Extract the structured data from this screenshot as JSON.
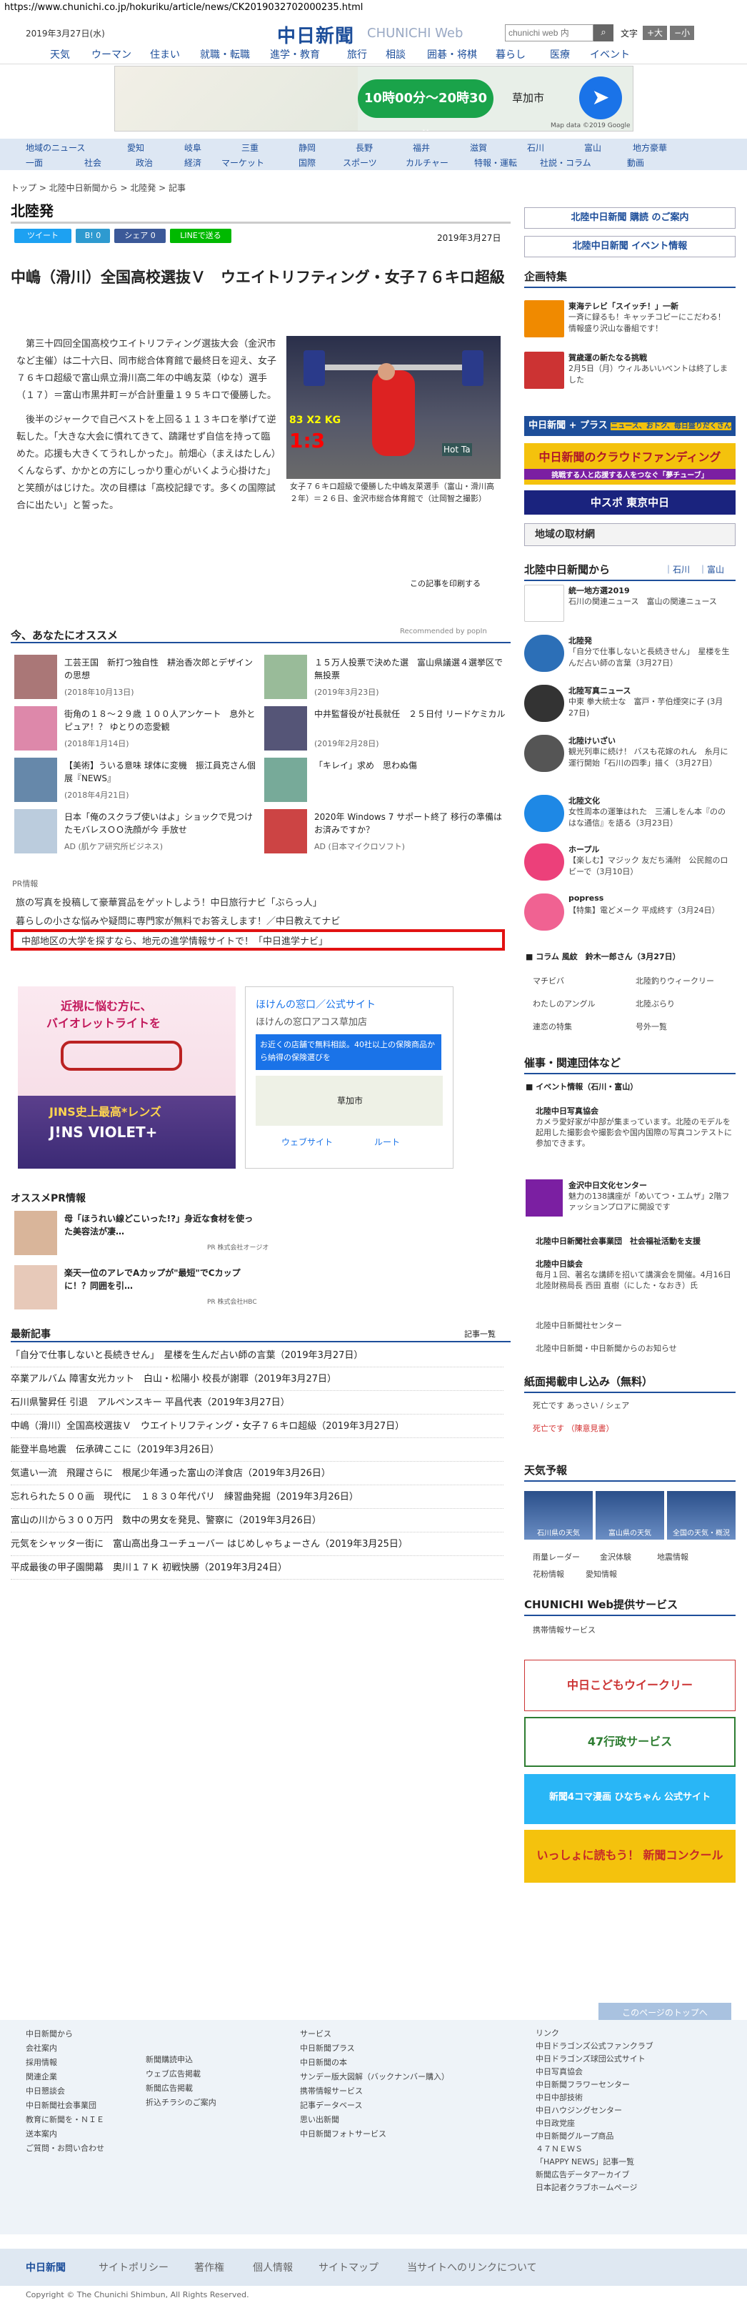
{
  "url": "https://www.chunichi.co.jp/hokuriku/article/news/CK2019032702000235.html",
  "header": {
    "date": "2019年3月27日(水)",
    "logo": "中日新聞",
    "logo_en": "CHUNICHI Web",
    "search_placeholder": "chunichi web 内",
    "font_label": "文字",
    "font_large": "+大",
    "font_small": "−小"
  },
  "nav1": [
    "天気",
    "ウーマン",
    "住まい",
    "就職・転職",
    "進学・教育",
    "旅行",
    "相談",
    "囲碁・将棋",
    "暮らし",
    "医療",
    "イベント"
  ],
  "ad_top": {
    "hours": "10時00分〜20時30分",
    "city": "草加市",
    "map_credit": "Map data ©2019 Google"
  },
  "nav2_row1": [
    "地域のニュース",
    "愛知",
    "岐阜",
    "三重",
    "静岡",
    "長野",
    "福井",
    "滋賀",
    "石川",
    "富山",
    "地方豪華"
  ],
  "nav2_row2": [
    "一面",
    "社会",
    "政治",
    "経済",
    "マーケット",
    "国際",
    "スポーツ",
    "カルチャー",
    "特報・運転",
    "社説・コラム",
    "動画"
  ],
  "breadcrumb": "トップ > 北陸中日新聞から > 北陸発 > 記事",
  "section": "北陸発",
  "share": [
    "ツイート",
    "B! 0",
    "シェア 0",
    "LINEで送る"
  ],
  "article_date": "2019年3月27日",
  "title": "中嶋（滑川）全国高校選抜Ｖ　ウエイトリフティング・女子７６キロ超級",
  "body": [
    "第三十四回全国高校ウエイトリフティング選抜大会（金沢市など主催）は二十六日、同市総合体育館で最終日を迎え、女子７６キロ超級で富山県立滑川高二年の中嶋友菜（ゆな）選手（１７）＝富山市黒井町＝が合計重量１９５キロで優勝した。",
    "後半のジャークで自己ベストを上回る１１３キロを挙げて逆転した。「大きな大会に慣れてきて、躊躇せず自信を持って臨めた。応援も大きくてうれしかった」。前畑心（まえはたしん）くんならず、かかとの方にしっかり重心がいくよう心掛けた」と笑顔がはじけた。次の目標は「高校記録です。多くの国際試合に出たい」と誓った。"
  ],
  "photo": {
    "plates": "83 X2 KG",
    "timer": "1:3",
    "sign": "Hot Ta"
  },
  "caption": "女子７６キロ超級で優勝した中嶋友菜選手（富山・滑川高２年）＝２６日、金沢市総合体育館で（辻岡智之撮影）",
  "print_link": "この記事を印刷する",
  "osusume_title": "今、あなたにオススメ",
  "recommended": "Recommended by  popIn",
  "cards": [
    {
      "t": "工芸王国　新打つ独自性　耕治香次郎とデザインの思想",
      "d": "(2018年10月13日)"
    },
    {
      "t": "１５万人投票で決めた選　富山県議選４選挙区で無投票",
      "d": "(2019年3月23日)"
    },
    {
      "t": "街角の１８〜２９歳 １００人アンケート　息外とピュア！？ ゆとりの恋愛観",
      "d": "(2018年1月14日)"
    },
    {
      "t": "中井監督役が社長就任　２５日付 リードケミカル",
      "d": "(2019年2月28日)"
    },
    {
      "t": "【美術】ういる意味 球体に変機　振江員克さん個展『NEWS』",
      "d": "(2018年4月21日)"
    },
    {
      "t": "「キレイ」求め　思わぬ傷",
      "d": ""
    },
    {
      "t": "日本「俺のスクラブ使いはよ」ショックで見つけたモバレスＯＯ洗顔が今 手放せ",
      "d": "AD (肌ケア研究所ビジネス)"
    },
    {
      "t": "2020年 Windows 7 サポート終了 移行の準備はお済みですか？",
      "d": "AD (日本マイクロソフト)"
    }
  ],
  "pr_label": "PR情報",
  "pr_links": [
    "旅の写真を投稿して豪華賞品をゲットしよう！中日旅行ナビ「ぶらっ人」",
    "暮らしの小さな悩みや疑問に専門家が無料でお答えします！／中日教えてナビ",
    "中部地区の大学を探すなら、地元の進学情報サイトで！「中日進学ナビ」"
  ],
  "ad_glasses": {
    "copy1": "近視に悩む方に、",
    "copy2": "バイオレットライトを",
    "brand1": "JINS史上最高*レンズ",
    "brand2": "J!NS VIOLET+"
  },
  "ad_hoken": {
    "title": "ほけんの窓口／公式サイト",
    "field": "ほけんの窓口アコス草加店",
    "msg": "お近くの店舗で無料相談。40社以上の保険商品から納得の保険選びを",
    "city": "草加市",
    "web": "ウェブサイト",
    "route": "ルート"
  },
  "prinfo_title": "オススメPR情報",
  "prinfo": [
    {
      "t": "母「ほうれい線どこいった!?」身近な食材を使った美容法が凄…",
      "s": "PR  株式会社オージオ"
    },
    {
      "t": "楽天一位のアレでAカップが\"最短\"でCカップに！？同囲を引…",
      "s": "PR  株式会社HBC"
    }
  ],
  "news_title": "最新記事",
  "news_more": "記事一覧",
  "news": [
    "「自分で仕事しないと長続きせん」　星楼を生んだ占い師の言葉（2019年3月27日）",
    "卒業アルバム 障害女光カット　白山・松陽小 校長が謝罪（2019年3月27日）",
    "石川県警昇任 引退　アルペンスキー 平昌代表（2019年3月27日）",
    "中嶋（滑川）全国高校選抜Ｖ　ウエイトリフティング・女子７６キロ超級（2019年3月27日）",
    "能登半島地震　伝承碑ここに（2019年3月26日）",
    "気遣い一流　飛躍さらに　根尾少年通った富山の洋食店（2019年3月26日）",
    "忘れられた５００画　現代に　１８３０年代パリ　練習曲発掘（2019年3月26日）",
    "富山の川から３００万円　数中の男女を発見、警察に（2019年3月26日）",
    "元気をシャッター街に　富山高出身ユーチューバー はじめしゃちょーさん（2019年3月25日）",
    "平成最後の甲子園開幕　奥川１７Ｋ 初戦快勝（2019年3月24日）"
  ],
  "side": {
    "buy": "北陸中日新聞 購読 のご案内",
    "event": "北陸中日新聞 イベント情報",
    "kikaku": "企画特集",
    "k1a": "東海テレビ「スイッチ！」一新",
    "k1b": "一斉に録るも！キャッチコピーにこだわる！情報盛り沢山な番組です！",
    "k2a": "賀歳運の新たなる挑戦",
    "k2b": "2月5日（月）ウィルあいいべントは終了しました",
    "plus": "中日新聞 + プラス",
    "plus2": "ニュース、おトク、毎日盛りだくさん",
    "crowd": "中日新聞のクラウドファンディング",
    "crowd2": "挑戦する人と応援する人をつなぐ「夢チューブ」",
    "chupo": "中スポ 東京中日",
    "chiiki": "地域の取材網",
    "from": "北陸中日新聞から",
    "from_links": "｜石川　｜富山",
    "items": [
      {
        "a": "統一地方選2019",
        "b": "石川の関連ニュース　富山の関連ニュース"
      },
      {
        "a": "北陸発",
        "b": "「自分で仕事しないと長続きせん」　星楼を生んだ占い師の言葉（3月27日）"
      },
      {
        "a": "北陸写真ニュース",
        "b": "中東 拳大統士な　富戸・芋伯煙突に子 (3月27日)"
      },
      {
        "a": "北陸けいざい",
        "b": "観光列車に続け！ バスも花嫁のれん　糸月に運行開始「石川の四季」描く（3月27日）"
      },
      {
        "a": "北陸文化",
        "b": "女性周本の運筆はれた　三浦しをん本『ののはな通信』を語る（3月23日）"
      },
      {
        "a": "ホープル",
        "b": "【楽しむ】マジック 友だち涌附　公民館のロビーで（3月10日）"
      },
      {
        "a": "popress",
        "b": "【特集】電どメーク 平成終す（3月24日）"
      }
    ],
    "column": "■ コラム 風紋　鈴木一郎さん（3月27日）",
    "links": [
      "マチビバ",
      "北陸釣りウィークリー",
      "わたしのアングル",
      "北陸ぶらり",
      "連恋の特集",
      "号外一覧"
    ],
    "events_title": "催事・関連団体など",
    "ev_info": "■ イベント情報（石川・富山）",
    "ev1a": "北陸中日写真協会",
    "ev1b": "カメラ愛好家が中部が集まっています。北陸のモデルを起用した撮影会や撮影会や国内国際の写真コンテストに参加できます。",
    "ev2a": "金沢中日文化センター",
    "ev2b": "魅力の138講座が「めいてつ・エムザ」2階ファッションプロアに開設です",
    "ev3": "北陸中日新聞社会事業団　社会福祉活動を支援",
    "ev4a": "北陸中日談会",
    "ev4b": "毎月１回、著名な講師を招いて講演会を開催。4月16日 北陸財務局長 西田 直樹（にした・なおき）氏",
    "ev5": "北陸中日新聞社センター",
    "ev6": "北陸中日新聞・中日新聞からのお知らせ",
    "shimen": "紙面掲載申し込み（無料）",
    "sh1": "死亡です あっさい / シェア",
    "sh2": "死亡です （陳意見書）",
    "tenki": "天気予報",
    "w": [
      "石川県の天気",
      "富山県の天気",
      "全国の天気・概況"
    ],
    "wlinks": [
      "雨量レーダー",
      "金沢体験",
      "地震情報",
      "花粉情報",
      "愛知情報"
    ],
    "svc": "CHUNICHI Web提供サービス",
    "svc1": "携帯情報サービス",
    "ban1": "中日こどもウイークリー",
    "ban2": "47行政サービス",
    "ban3": "新聞4コマ漫画 ひなちゃん 公式サイト",
    "ban4": "いっしょに読もう！ 新聞コンクール"
  },
  "pagetop": "このページのトップへ",
  "footer": {
    "c1": [
      "中日新聞から",
      "会社案内",
      "採用情報",
      "関連企業",
      "中日懇談会",
      "中日新聞社会事業団",
      "教育に新聞を・ＮＩＥ",
      "送本案内",
      "ご質問・お問い合わせ"
    ],
    "c2": [
      "新聞購読申込",
      "ウェブ広告掲載",
      "新聞広告掲載",
      "折込チラシのご案内"
    ],
    "c3": [
      "サービス",
      "中日新聞プラス",
      "中日新聞の本",
      "サンデー版大図解（バックナンバー購入）",
      "携帯情報サービス",
      "記事データベース",
      "思い出新聞",
      "中日新聞フォトサービス"
    ],
    "c4": [
      "リンク",
      "中日ドラゴンズ公式ファンクラブ",
      "中日ドラゴンズ球団公式サイト",
      "中日写真協会",
      "中日新聞フラワーセンター",
      "中日中部技術",
      "中日ハウジングセンター",
      "中日政党座",
      "中日新聞グループ商品",
      "４７ＮＥＷＳ",
      "「HAPPY NEWS」記事一覧",
      "新聞広告データアーカイブ",
      "日本記者クラブホームページ"
    ]
  },
  "foot2": [
    "中日新聞",
    "サイトポリシー",
    "著作権",
    "個人情報",
    "サイトマップ",
    "当サイトへのリンクについて"
  ],
  "copyright": "Copyright © The Chunichi Shimbun, All Rights Reserved.",
  "colors": {
    "brand": "#1d4e9a",
    "red": "#e21212",
    "green": "#1aa34a"
  }
}
